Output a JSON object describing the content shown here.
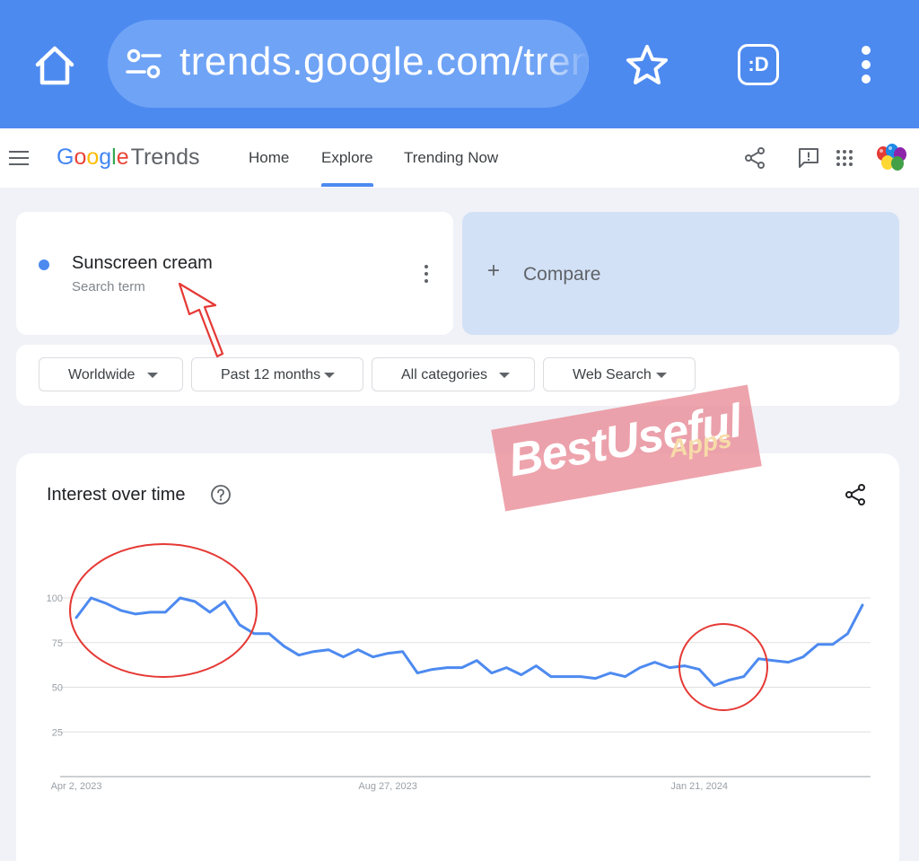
{
  "browser": {
    "url": "trends.google.com/trends/explore",
    "extension_label": ":D"
  },
  "header": {
    "logo_google": [
      "G",
      "o",
      "o",
      "g",
      "l",
      "e"
    ],
    "logo_trends": "Trends",
    "nav": [
      {
        "label": "Home"
      },
      {
        "label": "Explore"
      },
      {
        "label": "Trending Now"
      }
    ]
  },
  "term": {
    "name": "Sunscreen cream",
    "subtitle": "Search term",
    "color": "#4d8af0"
  },
  "compare": {
    "plus": "+",
    "label": "Compare"
  },
  "filters": [
    {
      "label": "Worldwide"
    },
    {
      "label": "Past 12 months"
    },
    {
      "label": "All categories"
    },
    {
      "label": "Web Search"
    }
  ],
  "watermark": {
    "main": "BestUseful",
    "sub": "Apps"
  },
  "chart": {
    "title": "Interest over time"
  },
  "chart_data": {
    "type": "line",
    "title": "Interest over time",
    "ylim": [
      0,
      100
    ],
    "y_ticks": [
      25,
      50,
      75,
      100
    ],
    "x_tick_labels": [
      "Apr 2, 2023",
      "Aug 27, 2023",
      "Jan 21, 2024"
    ],
    "x_tick_index": [
      0,
      21,
      42
    ],
    "grid": true,
    "series": [
      {
        "color": "#4d8af0",
        "values": [
          89,
          100,
          97,
          93,
          91,
          92,
          92,
          100,
          98,
          92,
          98,
          85,
          80,
          80,
          73,
          68,
          70,
          71,
          67,
          71,
          67,
          69,
          70,
          58,
          60,
          61,
          61,
          65,
          58,
          61,
          57,
          62,
          56,
          56,
          56,
          55,
          58,
          56,
          61,
          64,
          61,
          62,
          60,
          51,
          54,
          56,
          66,
          65,
          64,
          67,
          74,
          74,
          80,
          96
        ]
      }
    ]
  }
}
